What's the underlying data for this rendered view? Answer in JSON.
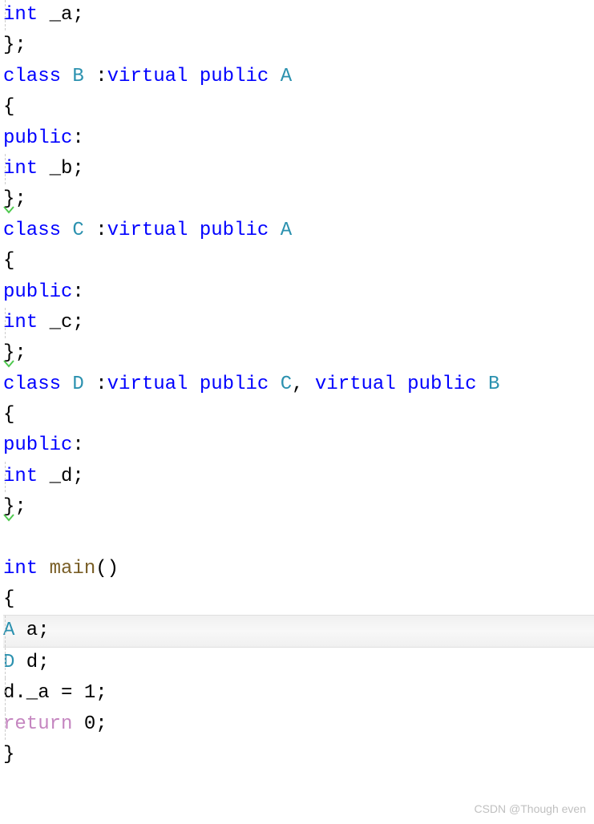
{
  "code": {
    "line1_int": "int",
    "line1_var": " _a;",
    "line2": "};",
    "line3_class": "class",
    "line3_name": " B ",
    "line3_colon": ":",
    "line3_virtual": "virtual",
    "line3_public": " public ",
    "line3_base": "A",
    "line4": "{",
    "line5_public": "public",
    "line5_colon": ":",
    "line6_int": "int",
    "line6_var": " _b;",
    "line7": "};",
    "line8_class": "class",
    "line8_name": " C ",
    "line8_colon": ":",
    "line8_virtual": "virtual",
    "line8_public": " public ",
    "line8_base": "A",
    "line9": "{",
    "line10_public": "public",
    "line10_colon": ":",
    "line11_int": "int",
    "line11_var": " _c;",
    "line12": "};",
    "line13_class": "class",
    "line13_name": " D ",
    "line13_colon": ":",
    "line13_virtual1": "virtual",
    "line13_public1": " public ",
    "line13_base1": "C",
    "line13_comma": ", ",
    "line13_virtual2": "virtual",
    "line13_public2": " public ",
    "line13_base2": "B",
    "line14": "{",
    "line15_public": "public",
    "line15_colon": ":",
    "line16_int": "int",
    "line16_var": " _d;",
    "line17": "};",
    "line19_int": "int",
    "line19_main": " main",
    "line19_parens": "()",
    "line20": "{",
    "line21_type": "A",
    "line21_var": " a;",
    "line22_type": "D",
    "line22_var": " d;",
    "line23": "d._a = 1;",
    "line24_return": "return",
    "line24_val": " 0;",
    "line25": "}"
  },
  "watermark": "CSDN @Though even"
}
